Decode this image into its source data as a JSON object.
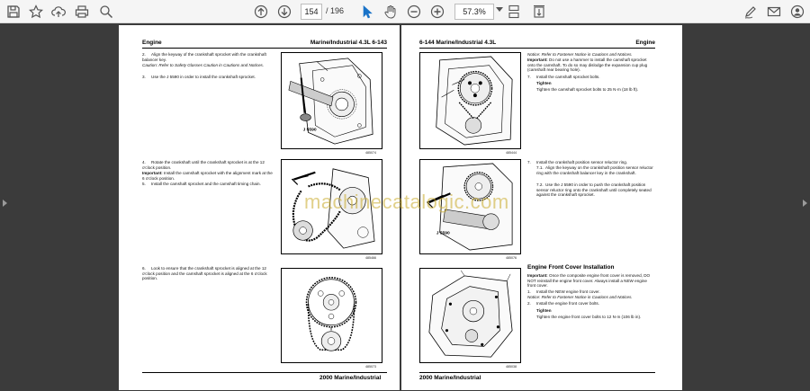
{
  "toolbar": {
    "page_current": "154",
    "page_separator": "/",
    "page_total": "196",
    "zoom": "57.3%"
  },
  "left_page": {
    "header_left": "Engine",
    "header_right": "Marine/Industrial 4.3L  6-143",
    "step2_num": "2.",
    "step2": "Align the keyway of the crankshaft sprocket with the crankshaft balancer key.",
    "caution": "Caution: Refer to Safety Glasses Caution in Cautions and Notices.",
    "step3_num": "3.",
    "step3": "Use the J 5590 in order to install the crankshaft sprocket.",
    "fig1_label": "J 5590",
    "fig1_code": "485074",
    "step4_num": "4.",
    "step4": "Rotate the crankshaft until the crankshaft sprocket is at the 12 o'clock position.",
    "important_label": "Important:",
    "important": "Install the camshaft sprocket with the alignment mark at the 6 o'clock position.",
    "step5_num": "5.",
    "step5": "Install the camshaft sprocket and the camshaft timing chain.",
    "fig2_code": "485466",
    "step6_num": "6.",
    "step6": "Look to ensure that the crankshaft sprocket is aligned at the 12 o'clock position and the camshaft sprocket is aligned at the 6 o'clock position.",
    "fig3_code": "485073",
    "footer": "2000 Marine/Industrial"
  },
  "right_page": {
    "header_left": "6-144   Marine/Industrial 4.3L",
    "header_right": "Engine",
    "notice1": "Notice: Refer to Fastener Notice in Cautions and Notices.",
    "important1_label": "Important:",
    "important1": "Do not use a hammer to install the camshaft sprocket onto the camshaft. To do so may dislodge the expansion cup plug (camshaft rear bearing hole).",
    "step7_num": "7.",
    "step7": "Install the camshaft sprocket bolts.",
    "tighten_label": "Tighten",
    "tighten1": "Tighten the camshaft sprocket bolts to 25 N·m (18 lb ft).",
    "fig1_code": "485444",
    "step7b_num": "7.",
    "step7b": "Install the crankshaft position sensor reluctor ring.",
    "step71_num": "7.1.",
    "step71": "Align the keyway on the crankshaft position sensor reluctor ring with the crankshaft balancer key in the crankshaft.",
    "step72_num": "7.2.",
    "step72": "Use the J 5590 in order to push the crankshaft position sensor reluctor ring onto the crankshaft until completely seated against the crankshaft sprocket.",
    "fig2_label": "J 5590",
    "fig2_code": "485076",
    "section_title": "Engine Front Cover Installation",
    "important2_label": "Important:",
    "important2": "Once the composite engine front cover is removed, DO NOT reinstall the engine front cover. Always install a NEW engine front cover.",
    "step1_num": "1.",
    "step1": "Install the NEW engine front cover.",
    "notice2": "Notice: Refer to Fastener Notice in Cautions and Notices.",
    "step2_num": "2.",
    "step2": "Install the engine front cover bolts.",
    "tighten2_label": "Tighten",
    "tighten2": "Tighten the engine front cover bolts to 12 N·m (106 lb in).",
    "fig3_code": "485038",
    "footer": "2000 Marine/Industrial"
  },
  "watermark": "machinecatalogic.com"
}
